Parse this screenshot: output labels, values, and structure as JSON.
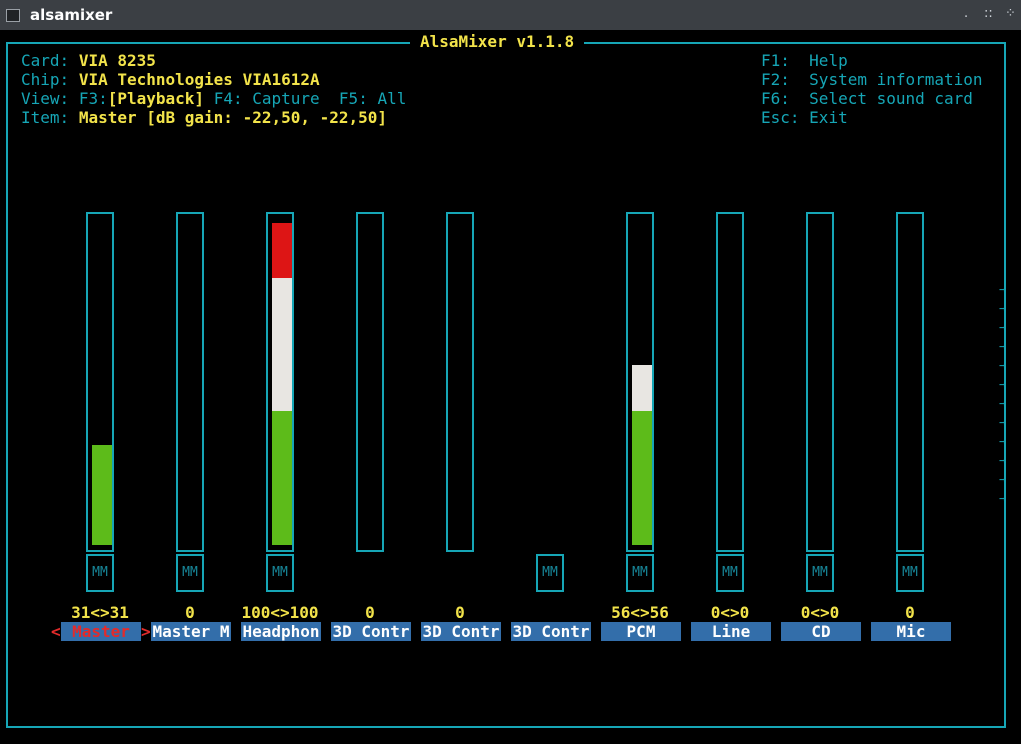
{
  "window": {
    "title": "alsamixer",
    "btn_minimize": ".",
    "btn_restore": "::",
    "btn_close": "⁘"
  },
  "header": {
    "app_title": "AlsaMixer v1.1.8",
    "card_label": "Card:",
    "card_value": "VIA 8235",
    "chip_label": "Chip:",
    "chip_value": "VIA Technologies VIA1612A",
    "view_label": "View:",
    "view_f3": "F3:",
    "view_playback": "[Playback]",
    "view_f4": "F4: Capture",
    "view_f5": "F5: All",
    "item_label": "Item:",
    "item_value": "Master [dB gain: -22,50, -22,50]"
  },
  "help": [
    {
      "key": "F1:",
      "label": "Help"
    },
    {
      "key": "F2:",
      "label": "System information"
    },
    {
      "key": "F6:",
      "label": "Select sound card"
    },
    {
      "key": "Esc:",
      "label": "Exit"
    }
  ],
  "scroll_arrow": "→",
  "selection_markers": {
    "left": "<",
    "right": ">"
  },
  "controls": [
    {
      "name": "Master",
      "volume_text": "31<>31",
      "level_percent": 31,
      "has_bar": true,
      "mute": "MM",
      "selected": true
    },
    {
      "name": "Master M",
      "volume_text": "0",
      "level_percent": 0,
      "has_bar": true,
      "mute": "MM",
      "selected": false
    },
    {
      "name": "Headphon",
      "volume_text": "100<>100",
      "level_percent": 100,
      "has_bar": true,
      "mute": "MM",
      "selected": false
    },
    {
      "name": "3D Contr",
      "volume_text": "0",
      "level_percent": 0,
      "has_bar": true,
      "mute": "",
      "selected": false
    },
    {
      "name": "3D Contr",
      "volume_text": "0",
      "level_percent": 0,
      "has_bar": true,
      "mute": "",
      "selected": false
    },
    {
      "name": "3D Contr",
      "volume_text": "",
      "level_percent": 0,
      "has_bar": false,
      "mute": "MM",
      "selected": false
    },
    {
      "name": "PCM",
      "volume_text": "56<>56",
      "level_percent": 56,
      "has_bar": true,
      "mute": "MM",
      "selected": false
    },
    {
      "name": "Line",
      "volume_text": "0<>0",
      "level_percent": 0,
      "has_bar": true,
      "mute": "MM",
      "selected": false
    },
    {
      "name": "CD",
      "volume_text": "0<>0",
      "level_percent": 0,
      "has_bar": true,
      "mute": "MM",
      "selected": false
    },
    {
      "name": "Mic",
      "volume_text": "0",
      "level_percent": 0,
      "has_bar": true,
      "mute": "MM",
      "selected": false
    }
  ],
  "colors": {
    "frame": "#16a6b6",
    "title": "#f2e34a",
    "bar_low": "#5dbb1a",
    "bar_mid": "#e8e6e2",
    "bar_high": "#dd1515",
    "name_bg": "#336eaa",
    "selected": "#e32b2b"
  }
}
